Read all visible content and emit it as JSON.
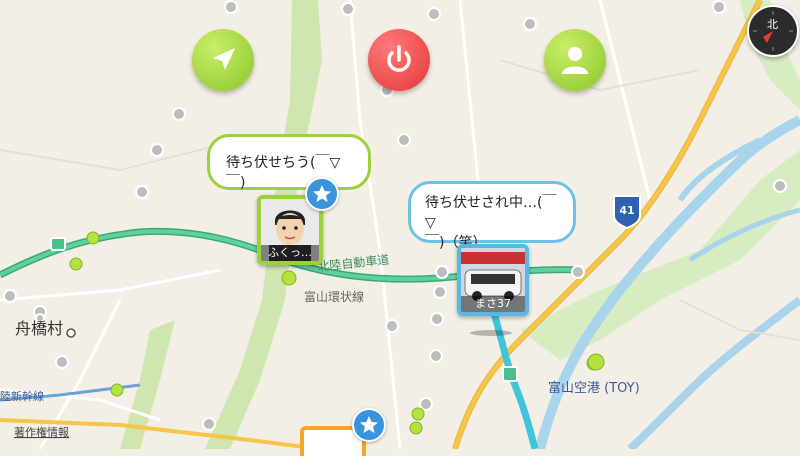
{
  "map": {
    "village_label": "舟橋村",
    "highway_label": "北陸自動車道",
    "ring_road_label": "富山環状線",
    "airport_label": "富山空港 (TOY)",
    "shinkansen_label": "陸新幹線",
    "route_shield": "41",
    "copyright_link": "著作権情報",
    "colors": {
      "land": "#f3efe6",
      "green_area": "#cfe6b0",
      "river": "#a8d4ec",
      "highway": "#4cbf88",
      "national_road": "#f6c64a",
      "route_line": "#3fc5d9"
    }
  },
  "toolbar": {
    "navigate_icon": "navigation-arrow-icon",
    "power_icon": "power-icon",
    "profile_icon": "person-icon",
    "compass_label": "北"
  },
  "users": [
    {
      "name": "ふくっ…",
      "message": "待ち伏せちう(￣▽￣)",
      "badge_icon": "star-icon"
    },
    {
      "name": "まさ37",
      "message_line1": "待ち伏せされ中…(￣▽",
      "message_line2": "￣)（笑）"
    }
  ],
  "bottom_marker": {
    "badge_icon": "star-icon"
  }
}
